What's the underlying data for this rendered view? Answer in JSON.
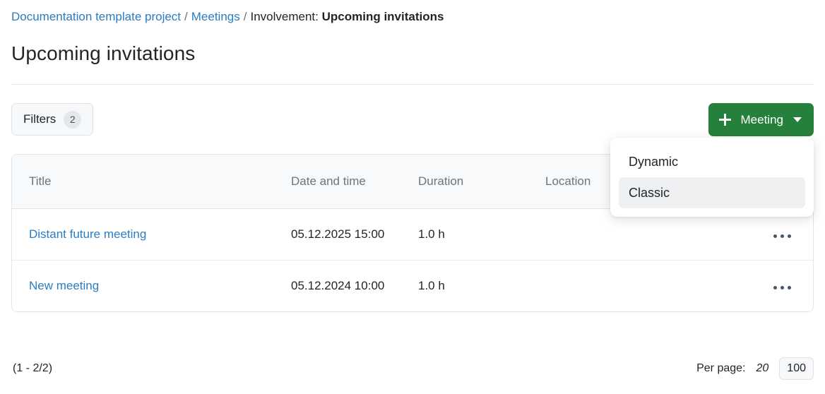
{
  "breadcrumb": {
    "project": "Documentation template project",
    "section": "Meetings",
    "prefix": "Involvement:",
    "current": "Upcoming invitations",
    "separator": "/"
  },
  "page_title": "Upcoming invitations",
  "toolbar": {
    "filters_label": "Filters",
    "filters_count": "2",
    "meeting_label": "Meeting",
    "meeting_button_color": "#25803b"
  },
  "dropdown": {
    "items": [
      {
        "label": "Dynamic",
        "active": false
      },
      {
        "label": "Classic",
        "active": true
      }
    ]
  },
  "table": {
    "columns": [
      "Title",
      "Date and time",
      "Duration",
      "Location",
      ""
    ],
    "rows": [
      {
        "title": "Distant future meeting",
        "datetime": "05.12.2025 15:00",
        "duration": "1.0 h",
        "location": "",
        "actions": "more-actions"
      },
      {
        "title": "New meeting",
        "datetime": "05.12.2024 10:00",
        "duration": "1.0 h",
        "location": "",
        "actions": "more-actions"
      }
    ]
  },
  "footer": {
    "range": "(1 - 2/2)",
    "per_page_label": "Per page:",
    "per_page_options": [
      "20",
      "100"
    ],
    "per_page_selected": "100"
  },
  "colors": {
    "link": "#2b7cc0",
    "accent_green": "#25803b",
    "muted": "#6c757d",
    "border": "#e1e5ea"
  }
}
